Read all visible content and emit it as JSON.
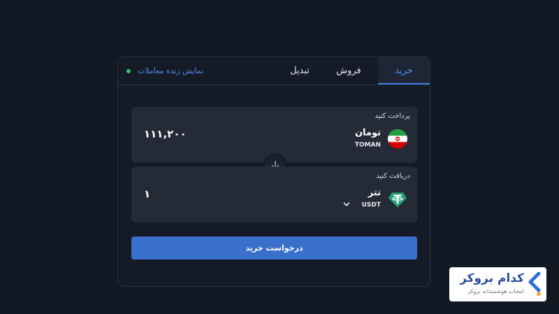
{
  "tabs": {
    "buy": "خرید",
    "sell": "فروش",
    "convert": "تبدیل"
  },
  "live_trades": "نمایش زنده معاملات",
  "pay": {
    "label": "پرداخت کنید",
    "currency_name": "تومان",
    "currency_code": "TOMAN",
    "amount": "۱۱۱,۲۰۰",
    "flag_icon": "iran-flag-icon"
  },
  "receive": {
    "label": "دریافت کنید",
    "currency_name": "تتر",
    "currency_code": "USDT",
    "amount": "۱",
    "currency_icon": "tether-icon"
  },
  "submit_label": "درخواست خرید",
  "brand": {
    "name": "کدام بروکر",
    "tagline": "انتخاب هوشمندانه بروکر"
  },
  "colors": {
    "accent": "#3b6fcc",
    "active_tab_text": "#4c8ef0",
    "live_dot": "#31c46b",
    "tether": "#26a17b"
  }
}
